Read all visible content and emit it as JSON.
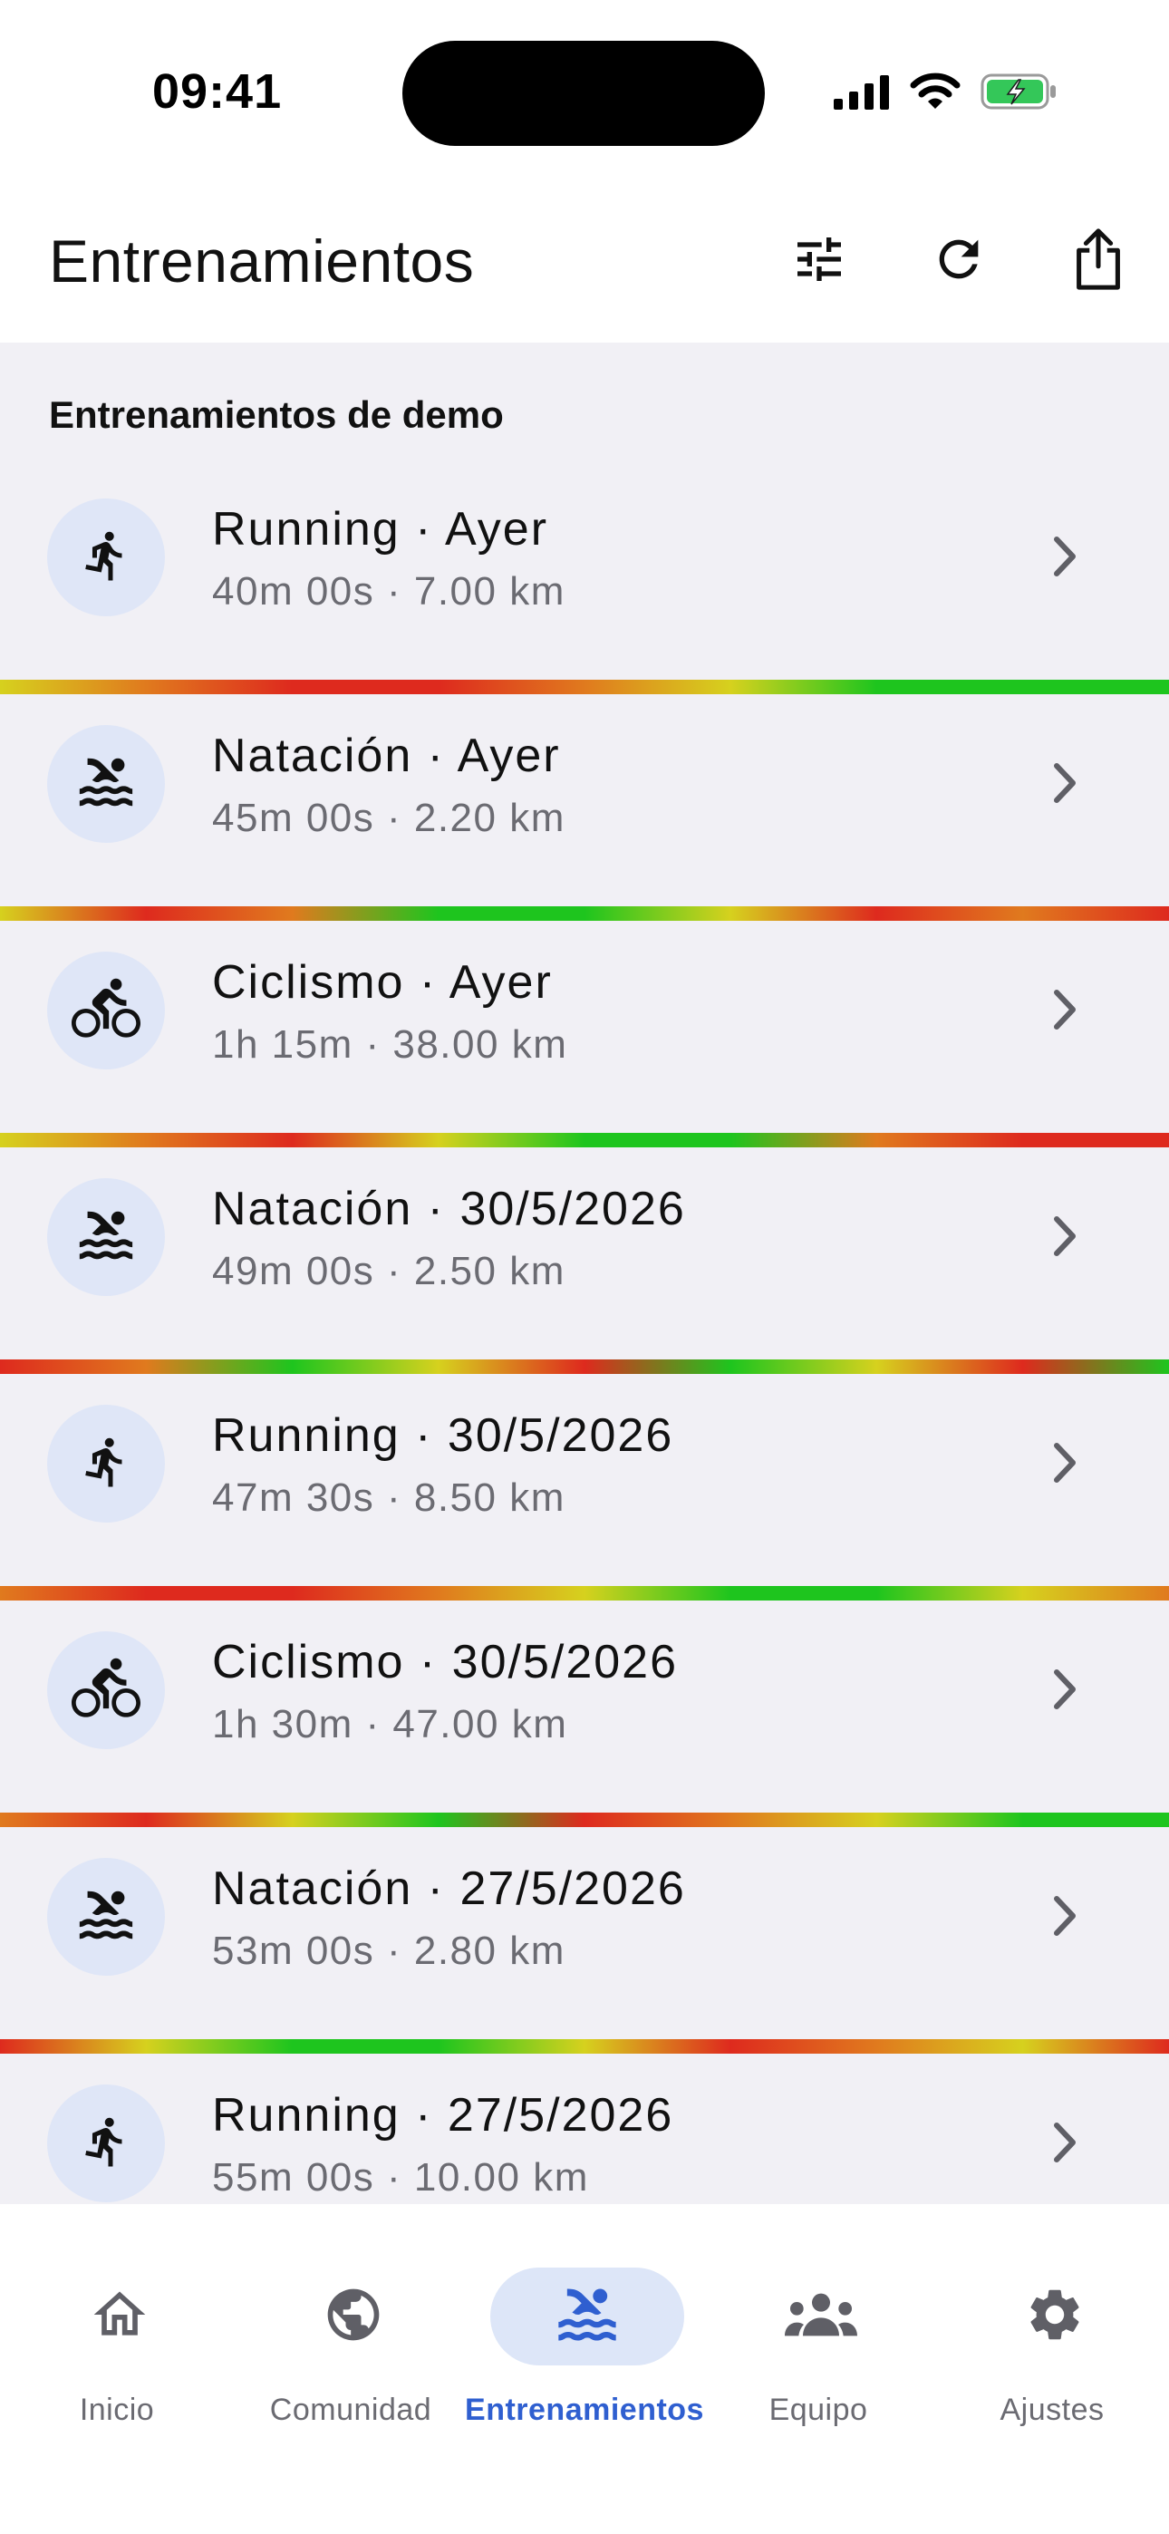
{
  "status_bar": {
    "time": "09:41",
    "icons": [
      "signal-icon",
      "wifi-icon",
      "battery-charging-icon"
    ]
  },
  "header": {
    "title": "Entrenamientos",
    "actions": [
      "filter-icon",
      "refresh-icon",
      "share-icon"
    ]
  },
  "section": {
    "title": "Entrenamientos de demo"
  },
  "workouts": [
    {
      "sport": "running",
      "icon": "running-icon",
      "title": "Running · Ayer",
      "detail": "40m 00s · 7.00 km"
    },
    {
      "sport": "swimming",
      "icon": "swimming-icon",
      "title": "Natación · Ayer",
      "detail": "45m 00s · 2.20 km"
    },
    {
      "sport": "cycling",
      "icon": "cycling-icon",
      "title": "Ciclismo · Ayer",
      "detail": "1h 15m · 38.00 km"
    },
    {
      "sport": "swimming",
      "icon": "swimming-icon",
      "title": "Natación · 30/5/2026",
      "detail": "49m 00s · 2.50 km"
    },
    {
      "sport": "running",
      "icon": "running-icon",
      "title": "Running · 30/5/2026",
      "detail": "47m 30s · 8.50 km"
    },
    {
      "sport": "cycling",
      "icon": "cycling-icon",
      "title": "Ciclismo · 30/5/2026",
      "detail": "1h 30m · 47.00 km"
    },
    {
      "sport": "swimming",
      "icon": "swimming-icon",
      "title": "Natación · 27/5/2026",
      "detail": "53m 00s · 2.80 km"
    },
    {
      "sport": "running",
      "icon": "running-icon",
      "title": "Running · 27/5/2026",
      "detail": "55m 00s · 10.00 km"
    }
  ],
  "bottom_nav": [
    {
      "label": "Inicio",
      "icon": "home-icon",
      "active": false
    },
    {
      "label": "Comunidad",
      "icon": "globe-icon",
      "active": false
    },
    {
      "label": "Entrenamientos",
      "icon": "swimming-icon",
      "active": true
    },
    {
      "label": "Equipo",
      "icon": "team-icon",
      "active": false
    },
    {
      "label": "Ajustes",
      "icon": "gear-icon",
      "active": false
    }
  ],
  "colors": {
    "accent": "#2f5fd0",
    "icon_bg": "#dfe6f7",
    "list_bg": "#f1f0f5",
    "intensity_green": "#1ec51e",
    "intensity_yellow": "#d6d11e",
    "intensity_red": "#de2a1e"
  }
}
